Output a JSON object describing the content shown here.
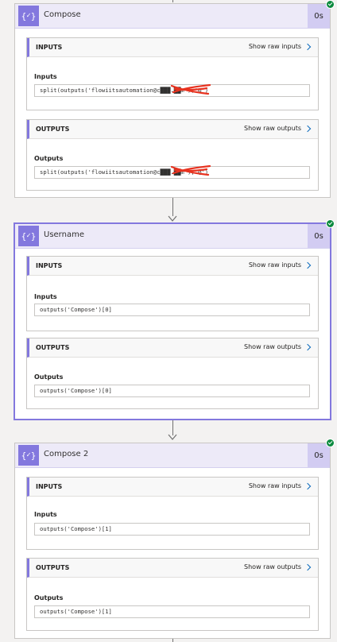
{
  "actions": [
    {
      "title": "Compose",
      "duration": "0s",
      "inputs": {
        "section_title": "INPUTS",
        "raw_link": "Show raw inputs",
        "field_label": "Inputs",
        "field_value": "split(outputs('flowiitsautomation@c███.██m'),'@')"
      },
      "outputs": {
        "section_title": "OUTPUTS",
        "raw_link": "Show raw outputs",
        "field_label": "Outputs",
        "field_value": "split(outputs('flowiitsautomation@c███.██m'),'@')"
      }
    },
    {
      "title": "Username",
      "duration": "0s",
      "inputs": {
        "section_title": "INPUTS",
        "raw_link": "Show raw inputs",
        "field_label": "Inputs",
        "field_value": "outputs('Compose')[0]"
      },
      "outputs": {
        "section_title": "OUTPUTS",
        "raw_link": "Show raw outputs",
        "field_label": "Outputs",
        "field_value": "outputs('Compose')[0]"
      }
    },
    {
      "title": "Compose 2",
      "duration": "0s",
      "inputs": {
        "section_title": "INPUTS",
        "raw_link": "Show raw inputs",
        "field_label": "Inputs",
        "field_value": "outputs('Compose')[1]"
      },
      "outputs": {
        "section_title": "OUTPUTS",
        "raw_link": "Show raw outputs",
        "field_label": "Outputs",
        "field_value": "outputs('Compose')[1]"
      }
    }
  ],
  "icons": {
    "action_icon": "compose-braces-icon",
    "status_icon": "success-check-icon",
    "link_icon": "chevron-right-icon",
    "connector_icon": "arrow-down-icon"
  },
  "colors": {
    "accent": "#8378de",
    "header_bg": "#edeaf8",
    "success": "#0b8a3e",
    "link": "#0f6cbd"
  }
}
